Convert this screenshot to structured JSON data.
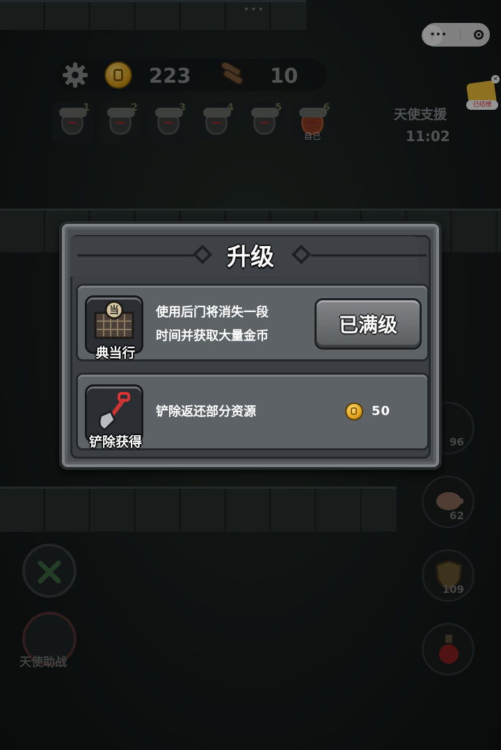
{
  "topbar": {
    "gold": "223",
    "wood": "10"
  },
  "slots": [
    {
      "num": "1",
      "label": ""
    },
    {
      "num": "2",
      "label": ""
    },
    {
      "num": "3",
      "label": ""
    },
    {
      "num": "4",
      "label": ""
    },
    {
      "num": "5",
      "label": ""
    },
    {
      "num": "6",
      "label": "自己"
    }
  ],
  "angel_support": {
    "label": "天使支援",
    "time": "11:02"
  },
  "rank_badge": "已结榜",
  "side_counts": {
    "poop": "96",
    "piggy": "62",
    "shield": "109"
  },
  "left_buttons": {
    "angel_assist": "天使助战"
  },
  "modal": {
    "title": "升级",
    "pawnshop": {
      "name": "典当行",
      "desc_line1": "使用后门将消失一段",
      "desc_line2": "时间并获取大量金币",
      "button": "已满级"
    },
    "shovel": {
      "name": "铲除获得",
      "desc": "铲除返还部分资源",
      "cost": "50"
    }
  }
}
